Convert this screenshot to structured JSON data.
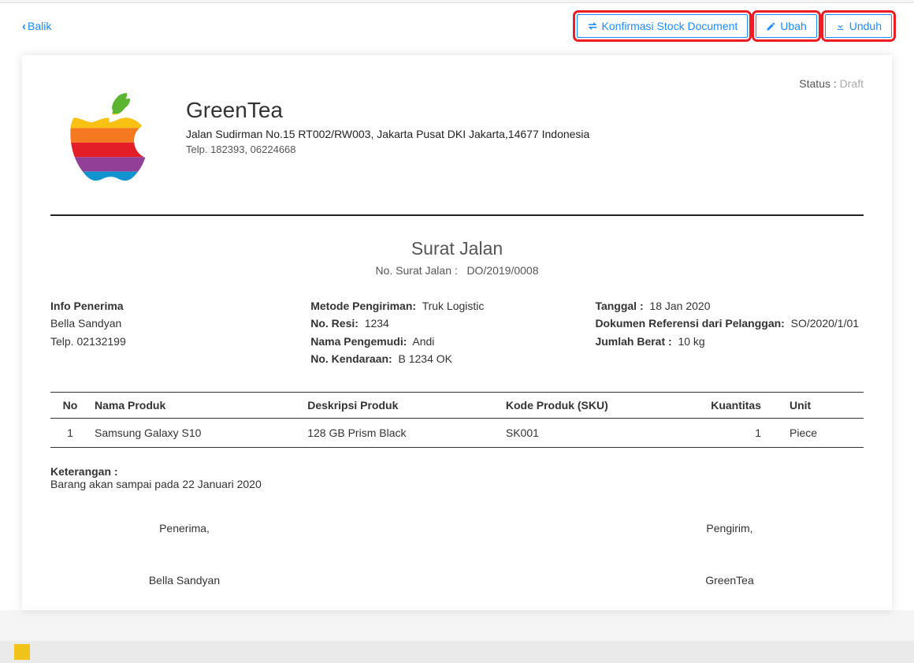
{
  "actions": {
    "back": "Balik",
    "konfirmasi": "Konfirmasi Stock Document",
    "ubah": "Ubah",
    "unduh": "Unduh"
  },
  "status_label": "Status :",
  "status_value": "Draft",
  "company": {
    "name": "GreenTea",
    "address": "Jalan Sudirman No.15 RT002/RW003, Jakarta Pusat DKI Jakarta,14677 Indonesia",
    "tel": "Telp. 182393, 06224668"
  },
  "doc": {
    "title": "Surat Jalan",
    "no_label": "No. Surat Jalan :",
    "no_value": "DO/2019/0008"
  },
  "receiver": {
    "heading": "Info Penerima",
    "name": "Bella Sandyan",
    "tel": "Telp. 02132199"
  },
  "shipping": {
    "method_label": "Metode Pengiriman:",
    "method_value": "Truk Logistic",
    "resi_label": "No. Resi:",
    "resi_value": "1234",
    "driver_label": "Nama Pengemudi:",
    "driver_value": "Andi",
    "vehicle_label": "No. Kendaraan:",
    "vehicle_value": "B 1234 OK"
  },
  "meta": {
    "date_label": "Tanggal :",
    "date_value": "18 Jan 2020",
    "ref_label": "Dokumen Referensi dari Pelanggan:",
    "ref_value": "SO/2020/1/01",
    "weight_label": "Jumlah Berat :",
    "weight_value": "10 kg"
  },
  "table": {
    "headers": {
      "no": "No",
      "name": "Nama Produk",
      "desc": "Deskripsi Produk",
      "sku": "Kode Produk (SKU)",
      "qty": "Kuantitas",
      "unit": "Unit"
    },
    "rows": [
      {
        "no": "1",
        "name": "Samsung Galaxy S10",
        "desc": "128 GB Prism Black",
        "sku": "SK001",
        "qty": "1",
        "unit": "Piece"
      }
    ]
  },
  "notes": {
    "label": "Keterangan :",
    "text": "Barang akan sampai pada 22 Januari 2020"
  },
  "signatures": {
    "receiver_label": "Penerima,",
    "receiver_name": "Bella Sandyan",
    "sender_label": "Pengirim,",
    "sender_name": "GreenTea"
  }
}
